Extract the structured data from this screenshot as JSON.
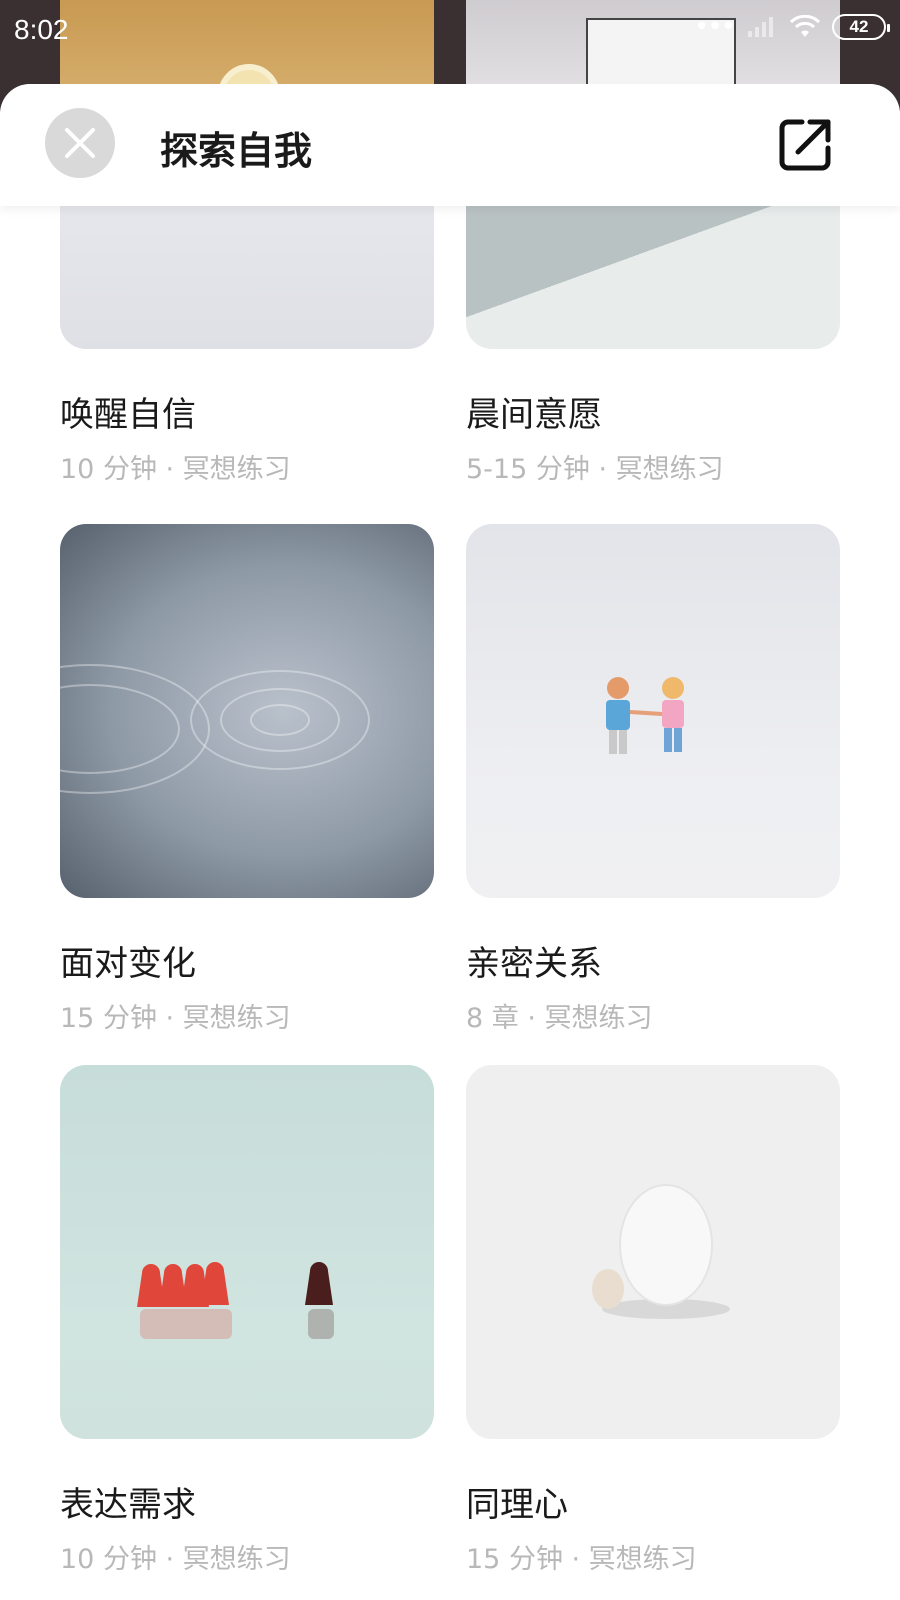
{
  "status_bar": {
    "time": "8:02",
    "battery": "42",
    "icons": [
      "dots-icon",
      "signal-icon",
      "wifi-icon",
      "battery-icon"
    ]
  },
  "header": {
    "title": "探索自我",
    "close_icon": "close-icon",
    "share_icon": "share-icon"
  },
  "cards": [
    {
      "title": "唤醒自信",
      "meta": "10 分钟 · 冥想练习"
    },
    {
      "title": "晨间意愿",
      "meta": "5-15 分钟 · 冥想练习"
    },
    {
      "title": "面对变化",
      "meta": "15 分钟 · 冥想练习"
    },
    {
      "title": "亲密关系",
      "meta": "8 章 · 冥想练习"
    },
    {
      "title": "表达需求",
      "meta": "10 分钟 · 冥想练习"
    },
    {
      "title": "同理心",
      "meta": "15 分钟 · 冥想练习"
    }
  ],
  "colors": {
    "sheet": "#ffffff",
    "title_text": "#1a1a1a",
    "meta_text": "#b8b8b8",
    "close_bg": "#d9d9d9"
  }
}
